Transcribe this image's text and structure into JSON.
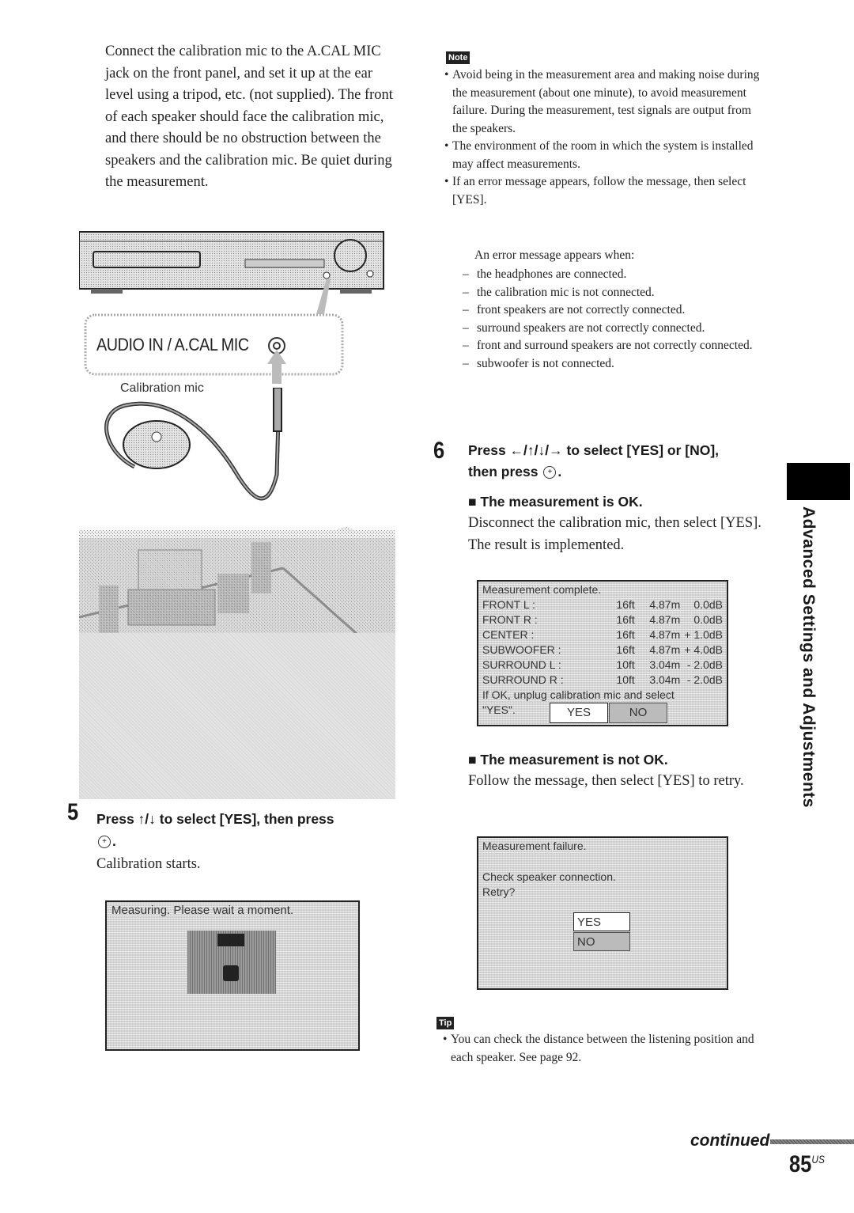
{
  "intro": {
    "paragraph": "Connect the calibration mic to the A.CAL MIC jack on the front panel, and set it up at the ear level using a tripod, etc. (not supplied). The front of each speaker should face the calibration mic, and there should be no obstruction between the speakers and the calibration mic. Be quiet during the measurement."
  },
  "illustration": {
    "jack_label": "AUDIO IN / A.CAL MIC",
    "mic_label": "Calibration mic"
  },
  "note": {
    "badge": "Note",
    "bullets": [
      "Avoid being in the measurement area and making noise during the measurement (about one minute), to avoid measurement failure. During the measurement, test signals are output from the speakers.",
      "The environment of the room in which the system is installed may affect measurements.",
      "If an error message appears, follow the message, then select [YES]."
    ],
    "error_intro": "An error message appears when:",
    "error_cases": [
      "the headphones are connected.",
      "the calibration mic is not connected.",
      "front speakers are not correctly connected.",
      "surround speakers are not correctly connected.",
      "front and surround speakers are not correctly connected.",
      "subwoofer is not connected."
    ]
  },
  "step5": {
    "number": "5",
    "title": "Press ↑/↓ to select [YES], then press",
    "button_symbol": "+",
    "title_end": ".",
    "body": "Calibration starts.",
    "osd": {
      "message": "Measuring. Please wait a moment."
    }
  },
  "step6": {
    "number": "6",
    "title_line1": "Press ←/↑/↓/→ to select [YES] or [NO],",
    "title_line2": "then press",
    "button_symbol": "+",
    "title_end": ".",
    "ok": {
      "heading": "■ The measurement is OK.",
      "body": "Disconnect the calibration mic, then select [YES]. The result is implemented.",
      "osd": {
        "title": "Measurement complete.",
        "rows": [
          {
            "speaker": "FRONT L :",
            "ft": "16ft",
            "m": "4.87m",
            "db": "0.0dB"
          },
          {
            "speaker": "FRONT R :",
            "ft": "16ft",
            "m": "4.87m",
            "db": "0.0dB"
          },
          {
            "speaker": "CENTER :",
            "ft": "16ft",
            "m": "4.87m",
            "db": "+ 1.0dB"
          },
          {
            "speaker": "SUBWOOFER :",
            "ft": "16ft",
            "m": "4.87m",
            "db": "+ 4.0dB"
          },
          {
            "speaker": "SURROUND L :",
            "ft": "10ft",
            "m": "3.04m",
            "db": "- 2.0dB"
          },
          {
            "speaker": "SURROUND R :",
            "ft": "10ft",
            "m": "3.04m",
            "db": "- 2.0dB"
          }
        ],
        "footer_line1": "If OK, unplug calibration mic and select",
        "footer_line2": "\"YES\".",
        "yes": "YES",
        "no": "NO"
      }
    },
    "not_ok": {
      "heading": "■ The measurement is not OK.",
      "body": "Follow the message, then select [YES] to retry.",
      "osd": {
        "title": "Measurement failure.",
        "line1": "Check speaker connection.",
        "line2": "Retry?",
        "yes": "YES",
        "no": "NO"
      }
    }
  },
  "tip": {
    "badge": "Tip",
    "bullets": [
      "You can check the distance between the listening position and each speaker. See page 92."
    ]
  },
  "side_tab": {
    "label": "Advanced Settings and Adjustments"
  },
  "footer": {
    "continued": "continued",
    "page_number": "85",
    "page_suffix": "US"
  }
}
